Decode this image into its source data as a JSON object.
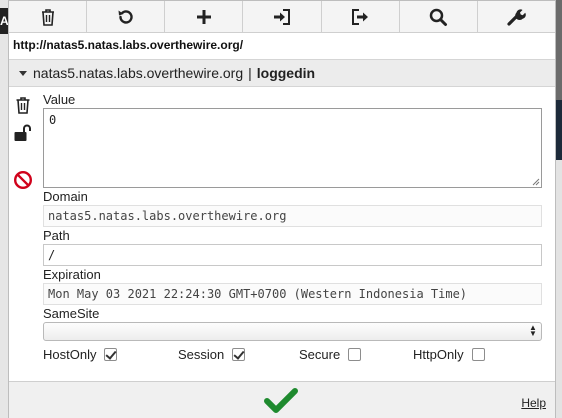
{
  "toolbar": {
    "icons": [
      "trash-icon",
      "refresh-icon",
      "add-icon",
      "import-icon",
      "export-icon",
      "search-icon",
      "wrench-icon"
    ]
  },
  "url": "http://natas5.natas.labs.overthewire.org/",
  "cookie": {
    "domain_label": "natas5.natas.labs.overthewire.org",
    "separator": "|",
    "name": "loggedin"
  },
  "form": {
    "value_label": "Value",
    "value": "0",
    "domain_label": "Domain",
    "domain": "natas5.natas.labs.overthewire.org",
    "path_label": "Path",
    "path": "/",
    "expiration_label": "Expiration",
    "expiration": "Mon May 03 2021 22:24:30 GMT+0700 (Western Indonesia Time)",
    "samesite_label": "SameSite",
    "samesite": ""
  },
  "flags": {
    "hostonly_label": "HostOnly",
    "hostonly": true,
    "session_label": "Session",
    "session": true,
    "secure_label": "Secure",
    "secure": false,
    "httponly_label": "HttpOnly",
    "httponly": false
  },
  "footer": {
    "help_label": "Help"
  },
  "colors": {
    "save_green": "#1e8a2e",
    "delete_red": "#d0021b"
  },
  "background_page": {
    "edge_text": "A"
  }
}
